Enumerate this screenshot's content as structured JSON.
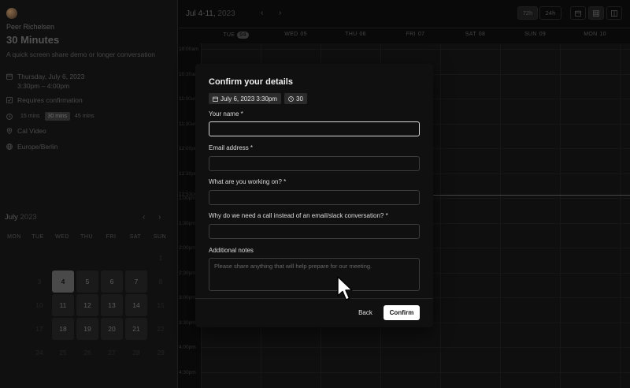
{
  "booker": {
    "host_name": "Peer Richelsen",
    "event_title": "30 Minutes",
    "event_description": "A quick screen share demo or longer conversation",
    "date_line": "Thursday, July 6, 2023",
    "time_line": "3:30pm – 4:00pm",
    "requires_confirmation": "Requires confirmation",
    "durations": [
      "15 mins",
      "30 mins",
      "45 mins"
    ],
    "selected_duration": "30 mins",
    "location": "Cal Video",
    "timezone": "Europe/Berlin"
  },
  "month_calendar": {
    "month": "July",
    "year": "2023",
    "prev_label": "‹",
    "next_label": "›",
    "weekdays": [
      "MON",
      "TUE",
      "WED",
      "THU",
      "FRI",
      "SAT",
      "SUN"
    ],
    "rows": [
      [
        "",
        "",
        "",
        "",
        "",
        "1",
        "2"
      ],
      [
        "3",
        "4",
        "5",
        "6",
        "7",
        "8",
        "9"
      ],
      [
        "10",
        "11",
        "12",
        "13",
        "14",
        "15",
        "16"
      ],
      [
        "17",
        "18",
        "19",
        "20",
        "21",
        "22",
        "23"
      ],
      [
        "24",
        "25",
        "26",
        "27",
        "28",
        "29",
        "30"
      ]
    ],
    "available_days": [
      "5",
      "6",
      "7",
      "11",
      "12",
      "13",
      "14",
      "18",
      "19",
      "20",
      "21"
    ],
    "selected_day": "4"
  },
  "week_view": {
    "range_label": "Jul 4-11,",
    "range_year": "2023",
    "prev_label": "‹",
    "next_label": "›",
    "toggle_72h": "72h",
    "toggle_24h": "24h",
    "columns": [
      {
        "day": "TUE",
        "date": "04"
      },
      {
        "day": "WED",
        "date": "05"
      },
      {
        "day": "THU",
        "date": "06"
      },
      {
        "day": "FRI",
        "date": "07"
      },
      {
        "day": "SAT",
        "date": "08"
      },
      {
        "day": "SUN",
        "date": "09"
      },
      {
        "day": "MON",
        "date": "10"
      }
    ],
    "time_labels": [
      "10:00am",
      "10:30am",
      "11:00am",
      "11:30am",
      "12:00pm",
      "12:30pm",
      "1:00pm",
      "1:30pm",
      "2:00pm",
      "2:30pm",
      "3:00pm",
      "3:30pm",
      "4:00pm",
      "4:30pm"
    ],
    "visible_time_label": "12:53pm"
  },
  "modal": {
    "title": "Confirm your details",
    "date_chip": "July 6, 2023 3:30pm",
    "duration_chip": "30",
    "fields": {
      "name_label": "Your name *",
      "name_value": "",
      "email_label": "Email address *",
      "email_value": "",
      "working_label": "What are you working on? *",
      "working_value": "",
      "why_label": "Why do we need a call instead of an email/slack conversation? *",
      "why_value": "",
      "notes_label": "Additional notes",
      "notes_placeholder": "Please share anything that will help prepare for our meeting."
    },
    "back_label": "Back",
    "confirm_label": "Confirm"
  },
  "icons": {
    "calendar": "calendar-icon",
    "check": "check-square-icon",
    "clock": "clock-icon",
    "location": "map-pin-icon",
    "globe": "globe-icon",
    "cursor": "mouse-pointer-icon"
  },
  "colors": {
    "modal_bg": "#101010",
    "confirm_bg": "#ffffff",
    "overlay": "#0c0c0c"
  }
}
